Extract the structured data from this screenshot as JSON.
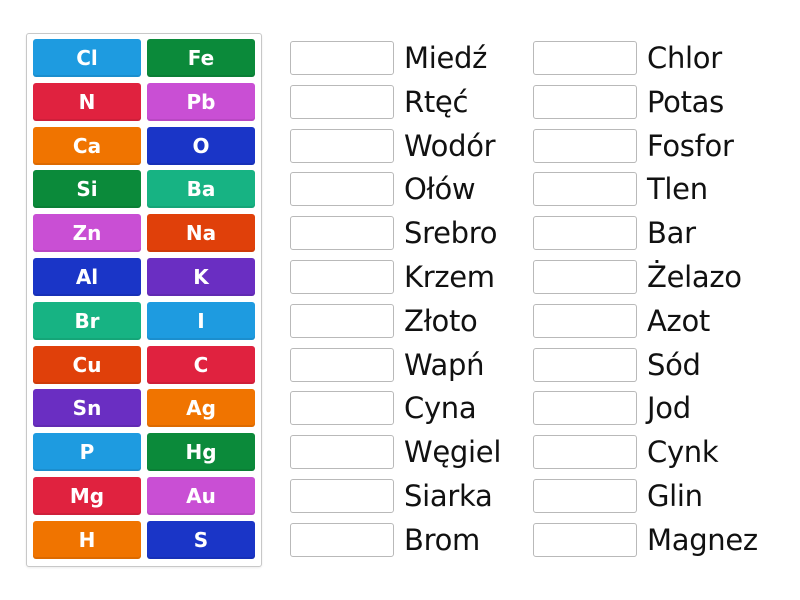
{
  "colors": {
    "blue": "#1e9be0",
    "green": "#0b8a3a",
    "red": "#e0223f",
    "purple": "#c94fd4",
    "orange": "#f07400",
    "navy": "#1a35c7",
    "teal": "#17b383",
    "vermilion": "#e0400a",
    "violet": "#6a2ec2"
  },
  "tiles": [
    {
      "symbol": "Cl",
      "color": "blue"
    },
    {
      "symbol": "Fe",
      "color": "green"
    },
    {
      "symbol": "N",
      "color": "red"
    },
    {
      "symbol": "Pb",
      "color": "purple"
    },
    {
      "symbol": "Ca",
      "color": "orange"
    },
    {
      "symbol": "O",
      "color": "navy"
    },
    {
      "symbol": "Si",
      "color": "green"
    },
    {
      "symbol": "Ba",
      "color": "teal"
    },
    {
      "symbol": "Zn",
      "color": "purple"
    },
    {
      "symbol": "Na",
      "color": "vermilion"
    },
    {
      "symbol": "Al",
      "color": "navy"
    },
    {
      "symbol": "K",
      "color": "violet"
    },
    {
      "symbol": "Br",
      "color": "teal"
    },
    {
      "symbol": "I",
      "color": "blue"
    },
    {
      "symbol": "Cu",
      "color": "vermilion"
    },
    {
      "symbol": "C",
      "color": "red"
    },
    {
      "symbol": "Sn",
      "color": "violet"
    },
    {
      "symbol": "Ag",
      "color": "orange"
    },
    {
      "symbol": "P",
      "color": "blue"
    },
    {
      "symbol": "Hg",
      "color": "green"
    },
    {
      "symbol": "Mg",
      "color": "red"
    },
    {
      "symbol": "Au",
      "color": "purple"
    },
    {
      "symbol": "H",
      "color": "orange"
    },
    {
      "symbol": "S",
      "color": "navy"
    }
  ],
  "targets_left": [
    "Miedź",
    "Rtęć",
    "Wodór",
    "Ołów",
    "Srebro",
    "Krzem",
    "Złoto",
    "Wapń",
    "Cyna",
    "Węgiel",
    "Siarka",
    "Brom"
  ],
  "targets_right": [
    "Chlor",
    "Potas",
    "Fosfor",
    "Tlen",
    "Bar",
    "Żelazo",
    "Azot",
    "Sód",
    "Jod",
    "Cynk",
    "Glin",
    "Magnez"
  ]
}
